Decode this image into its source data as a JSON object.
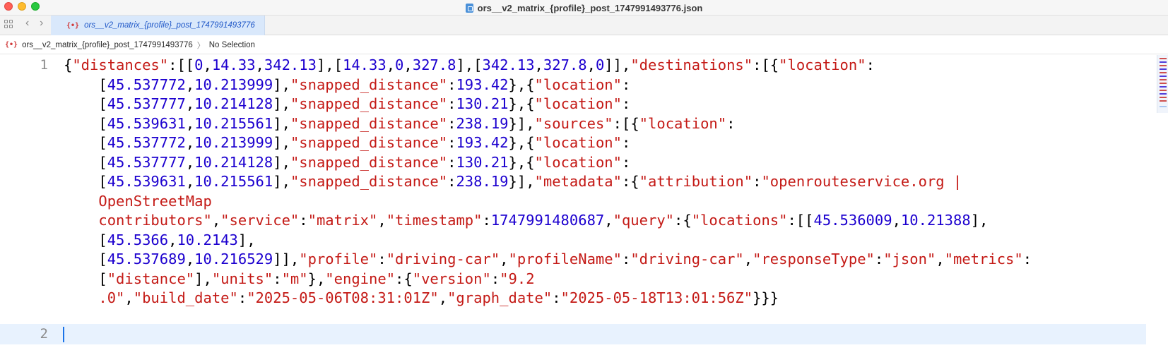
{
  "window": {
    "title": "ors__v2_matrix_{profile}_post_1747991493776.json"
  },
  "tab": {
    "label": "ors__v2_matrix_{profile}_post_1747991493776",
    "icon": "json-file-icon"
  },
  "breadcrumb": {
    "file": "ors__v2_matrix_{profile}_post_1747991493776",
    "separator": "〉",
    "selection": "No Selection"
  },
  "editor": {
    "line_numbers": [
      "1",
      "2"
    ],
    "lines": [
      [
        [
          "p",
          "{"
        ],
        [
          "k",
          "\"distances\""
        ],
        [
          "p",
          ":[["
        ],
        [
          "n",
          "0"
        ],
        [
          "p",
          ","
        ],
        [
          "n",
          "14.33"
        ],
        [
          "p",
          ","
        ],
        [
          "n",
          "342.13"
        ],
        [
          "p",
          "],["
        ],
        [
          "n",
          "14.33"
        ],
        [
          "p",
          ","
        ],
        [
          "n",
          "0"
        ],
        [
          "p",
          ","
        ],
        [
          "n",
          "327.8"
        ],
        [
          "p",
          "],["
        ],
        [
          "n",
          "342.13"
        ],
        [
          "p",
          ","
        ],
        [
          "n",
          "327.8"
        ],
        [
          "p",
          ","
        ],
        [
          "n",
          "0"
        ],
        [
          "p",
          "]],"
        ],
        [
          "k",
          "\"destinations\""
        ],
        [
          "p",
          ":[{"
        ],
        [
          "k",
          "\"location\""
        ],
        [
          "p",
          ":"
        ]
      ],
      [
        [
          "p",
          "    ["
        ],
        [
          "n",
          "45.537772"
        ],
        [
          "p",
          ","
        ],
        [
          "n",
          "10.213999"
        ],
        [
          "p",
          "],"
        ],
        [
          "k",
          "\"snapped_distance\""
        ],
        [
          "p",
          ":"
        ],
        [
          "n",
          "193.42"
        ],
        [
          "p",
          "},{"
        ],
        [
          "k",
          "\"location\""
        ],
        [
          "p",
          ":"
        ]
      ],
      [
        [
          "p",
          "    ["
        ],
        [
          "n",
          "45.537777"
        ],
        [
          "p",
          ","
        ],
        [
          "n",
          "10.214128"
        ],
        [
          "p",
          "],"
        ],
        [
          "k",
          "\"snapped_distance\""
        ],
        [
          "p",
          ":"
        ],
        [
          "n",
          "130.21"
        ],
        [
          "p",
          "},{"
        ],
        [
          "k",
          "\"location\""
        ],
        [
          "p",
          ":"
        ]
      ],
      [
        [
          "p",
          "    ["
        ],
        [
          "n",
          "45.539631"
        ],
        [
          "p",
          ","
        ],
        [
          "n",
          "10.215561"
        ],
        [
          "p",
          "],"
        ],
        [
          "k",
          "\"snapped_distance\""
        ],
        [
          "p",
          ":"
        ],
        [
          "n",
          "238.19"
        ],
        [
          "p",
          "}],"
        ],
        [
          "k",
          "\"sources\""
        ],
        [
          "p",
          ":[{"
        ],
        [
          "k",
          "\"location\""
        ],
        [
          "p",
          ":"
        ]
      ],
      [
        [
          "p",
          "    ["
        ],
        [
          "n",
          "45.537772"
        ],
        [
          "p",
          ","
        ],
        [
          "n",
          "10.213999"
        ],
        [
          "p",
          "],"
        ],
        [
          "k",
          "\"snapped_distance\""
        ],
        [
          "p",
          ":"
        ],
        [
          "n",
          "193.42"
        ],
        [
          "p",
          "},{"
        ],
        [
          "k",
          "\"location\""
        ],
        [
          "p",
          ":"
        ]
      ],
      [
        [
          "p",
          "    ["
        ],
        [
          "n",
          "45.537777"
        ],
        [
          "p",
          ","
        ],
        [
          "n",
          "10.214128"
        ],
        [
          "p",
          "],"
        ],
        [
          "k",
          "\"snapped_distance\""
        ],
        [
          "p",
          ":"
        ],
        [
          "n",
          "130.21"
        ],
        [
          "p",
          "},{"
        ],
        [
          "k",
          "\"location\""
        ],
        [
          "p",
          ":"
        ]
      ],
      [
        [
          "p",
          "    ["
        ],
        [
          "n",
          "45.539631"
        ],
        [
          "p",
          ","
        ],
        [
          "n",
          "10.215561"
        ],
        [
          "p",
          "],"
        ],
        [
          "k",
          "\"snapped_distance\""
        ],
        [
          "p",
          ":"
        ],
        [
          "n",
          "238.19"
        ],
        [
          "p",
          "}],"
        ],
        [
          "k",
          "\"metadata\""
        ],
        [
          "p",
          ":{"
        ],
        [
          "k",
          "\"attribution\""
        ],
        [
          "p",
          ":"
        ],
        [
          "k",
          "\"openrouteservice.org |"
        ]
      ],
      [
        [
          "k",
          "    OpenStreetMap"
        ]
      ],
      [
        [
          "k",
          "    contributors\""
        ],
        [
          "p",
          ","
        ],
        [
          "k",
          "\"service\""
        ],
        [
          "p",
          ":"
        ],
        [
          "k",
          "\"matrix\""
        ],
        [
          "p",
          ","
        ],
        [
          "k",
          "\"timestamp\""
        ],
        [
          "p",
          ":"
        ],
        [
          "n",
          "1747991480687"
        ],
        [
          "p",
          ","
        ],
        [
          "k",
          "\"query\""
        ],
        [
          "p",
          ":{"
        ],
        [
          "k",
          "\"locations\""
        ],
        [
          "p",
          ":[["
        ],
        [
          "n",
          "45.536009"
        ],
        [
          "p",
          ","
        ],
        [
          "n",
          "10.21388"
        ],
        [
          "p",
          "],"
        ]
      ],
      [
        [
          "p",
          "    ["
        ],
        [
          "n",
          "45.5366"
        ],
        [
          "p",
          ","
        ],
        [
          "n",
          "10.2143"
        ],
        [
          "p",
          "],"
        ]
      ],
      [
        [
          "p",
          "    ["
        ],
        [
          "n",
          "45.537689"
        ],
        [
          "p",
          ","
        ],
        [
          "n",
          "10.216529"
        ],
        [
          "p",
          "]],"
        ],
        [
          "k",
          "\"profile\""
        ],
        [
          "p",
          ":"
        ],
        [
          "k",
          "\"driving-car\""
        ],
        [
          "p",
          ","
        ],
        [
          "k",
          "\"profileName\""
        ],
        [
          "p",
          ":"
        ],
        [
          "k",
          "\"driving-car\""
        ],
        [
          "p",
          ","
        ],
        [
          "k",
          "\"responseType\""
        ],
        [
          "p",
          ":"
        ],
        [
          "k",
          "\"json\""
        ],
        [
          "p",
          ","
        ],
        [
          "k",
          "\"metrics\""
        ],
        [
          "p",
          ":"
        ]
      ],
      [
        [
          "p",
          "    ["
        ],
        [
          "k",
          "\"distance\""
        ],
        [
          "p",
          "],"
        ],
        [
          "k",
          "\"units\""
        ],
        [
          "p",
          ":"
        ],
        [
          "k",
          "\"m\""
        ],
        [
          "p",
          "},"
        ],
        [
          "k",
          "\"engine\""
        ],
        [
          "p",
          ":{"
        ],
        [
          "k",
          "\"version\""
        ],
        [
          "p",
          ":"
        ],
        [
          "k",
          "\"9.2"
        ]
      ],
      [
        [
          "k",
          "    .0\""
        ],
        [
          "p",
          ","
        ],
        [
          "k",
          "\"build_date\""
        ],
        [
          "p",
          ":"
        ],
        [
          "k",
          "\"2025-05-06T08:31:01Z\""
        ],
        [
          "p",
          ","
        ],
        [
          "k",
          "\"graph_date\""
        ],
        [
          "p",
          ":"
        ],
        [
          "k",
          "\"2025-05-18T13:01:56Z\""
        ],
        [
          "p",
          "}}}"
        ]
      ]
    ]
  },
  "colors": {
    "string": "#c41a16",
    "number": "#1c00cf",
    "punctuation": "#000000",
    "current_line": "#e8f2fe",
    "caret": "#1a73e8",
    "tab_active": "#d9e8fb"
  }
}
